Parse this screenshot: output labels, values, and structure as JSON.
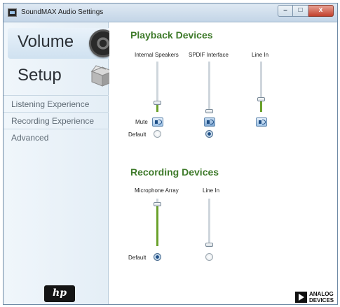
{
  "window": {
    "title": "SoundMAX Audio Settings",
    "minimize": "–",
    "maximize": "□",
    "close": "x"
  },
  "sidebar": {
    "volume_label": "Volume",
    "setup_label": "Setup",
    "items": [
      {
        "label": "Listening Experience"
      },
      {
        "label": "Recording Experience"
      },
      {
        "label": "Advanced"
      }
    ],
    "hp_logo": "hp"
  },
  "playback": {
    "title": "Playback Devices",
    "mute_label": "Mute",
    "default_label": "Default",
    "devices": [
      {
        "name": "Internal Speakers",
        "level": 0.18,
        "muted": false,
        "is_default": false
      },
      {
        "name": "SPDIF Interface",
        "level": 0.02,
        "muted": true,
        "is_default": true
      },
      {
        "name": "Line In",
        "level": 0.25,
        "muted": false,
        "is_default": null
      }
    ]
  },
  "recording": {
    "title": "Recording Devices",
    "default_label": "Default",
    "devices": [
      {
        "name": "Microphone Array",
        "level": 0.88,
        "is_default": true
      },
      {
        "name": "Line In",
        "level": 0.03,
        "is_default": false
      }
    ]
  },
  "analog_devices_logo": [
    "ANALOG",
    "DEVICES"
  ],
  "colors": {
    "accent_green": "#3e7a2a",
    "level_green": "#6aa12b",
    "sidebar_bg": "#e4eef6"
  },
  "icons": [
    "speaker-icon",
    "box-icon",
    "speaker-mute-icon",
    "hp-logo",
    "analog-devices-logo"
  ]
}
